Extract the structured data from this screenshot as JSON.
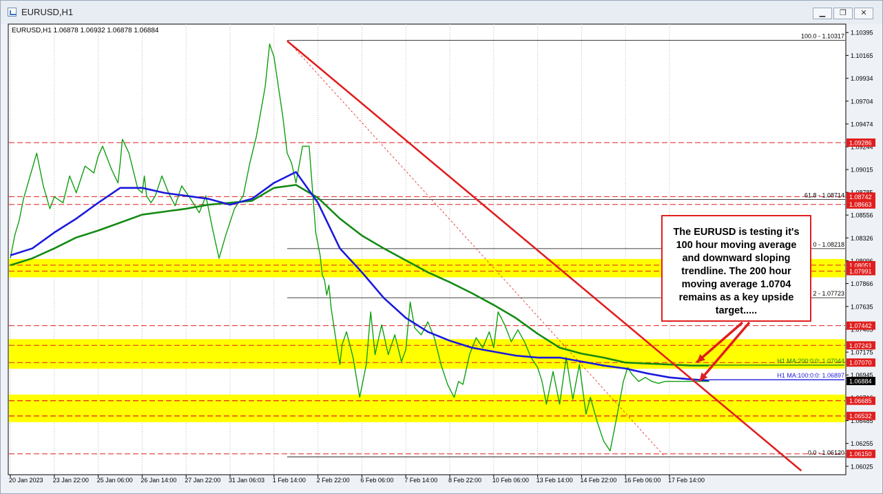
{
  "window": {
    "title": "EURUSD,H1",
    "buttons": [
      "minimize",
      "restore",
      "close"
    ]
  },
  "chart_header": "EURUSD,H1  1.06878 1.06932 1.06878 1.06884",
  "annotation": {
    "text": "The EURUSD is testing it's 100 hour moving average and downward sloping trendline. The 200 hour moving average 1.0704 remains as a key upside target....."
  },
  "colors": {
    "candle": "#0e9e0e",
    "ma100": "#1a1adc",
    "ma200": "#138a13",
    "trendline": "#e11e1e",
    "zone": "#ffff00",
    "level_line": "#e11e1e",
    "fib_line": "#000000"
  },
  "chart_data": {
    "type": "line",
    "symbol": "EURUSD",
    "timeframe": "H1",
    "ohlc_readout": {
      "open": 1.06878,
      "high": 1.06932,
      "low": 1.06878,
      "close": 1.06884
    },
    "ylim": [
      1.0594,
      1.1048
    ],
    "y_ticks": [
      "1.10395",
      "1.10165",
      "1.09934",
      "1.09704",
      "1.09474",
      "1.09244",
      "1.09015",
      "1.08785",
      "1.08556",
      "1.08326",
      "1.08096",
      "1.07866",
      "1.07635",
      "1.07405",
      "1.07175",
      "1.06945",
      "1.06716",
      "1.06485",
      "1.06255",
      "1.06025"
    ],
    "x_labels": [
      "20 Jan 2023",
      "23 Jan 22:00",
      "25 Jan 06:00",
      "26 Jan 14:00",
      "27 Jan 22:00",
      "31 Jan 06:03",
      "1 Feb 14:00",
      "2 Feb 22:00",
      "6 Feb 06:00",
      "7 Feb 14:00",
      "8 Feb 22:00",
      "10 Feb 06:00",
      "13 Feb 14:00",
      "14 Feb 22:00",
      "16 Feb 06:00",
      "17 Feb 14:00"
    ],
    "series": [
      {
        "name": "EURUSD,H1",
        "kind": "price",
        "x": [
          0,
          0.1,
          0.2,
          0.3,
          0.45,
          0.6,
          0.75,
          0.9,
          1,
          1.2,
          1.35,
          1.5,
          1.7,
          1.9,
          2,
          2.1,
          2.3,
          2.45,
          2.5,
          2.55,
          2.7,
          2.9,
          3,
          3.05,
          3.1,
          3.2,
          3.3,
          3.45,
          3.6,
          3.75,
          3.9,
          4.1,
          4.3,
          4.45,
          4.6,
          4.75,
          4.9,
          5.1,
          5.3,
          5.45,
          5.6,
          5.8,
          5.9,
          6,
          6.1,
          6.2,
          6.3,
          6.4,
          6.5,
          6.65,
          6.8,
          6.95,
          7.05,
          7.1,
          7.15,
          7.2,
          7.25,
          7.3,
          7.45,
          7.5,
          7.55,
          7.65,
          7.8,
          7.95,
          8.1,
          8.2,
          8.3,
          8.45,
          8.6,
          8.75,
          8.9,
          9,
          9.1,
          9.2,
          9.35,
          9.5,
          9.65,
          9.8,
          9.95,
          10.1,
          10.2,
          10.3,
          10.45,
          10.6,
          10.75,
          10.9,
          11,
          11.1,
          11.25,
          11.4,
          11.55,
          11.7,
          11.85,
          12,
          12.1,
          12.2,
          12.35,
          12.5,
          12.65,
          12.8,
          12.95,
          13.1,
          13.2,
          13.35,
          13.5,
          13.65,
          13.8,
          13.95,
          14.05,
          14.15,
          14.3,
          14.45,
          14.6,
          14.75,
          14.9,
          15.05,
          15.2,
          15.35,
          15.5,
          15.65,
          15.8,
          15.9
        ],
        "y": [
          1.0812,
          1.0835,
          1.085,
          1.0872,
          1.0895,
          1.0918,
          1.0885,
          1.0862,
          1.0874,
          1.0868,
          1.0895,
          1.0878,
          1.0905,
          1.0898,
          1.0915,
          1.0925,
          1.0902,
          1.0888,
          1.0908,
          1.0932,
          1.0918,
          1.0882,
          1.0878,
          1.0895,
          1.0875,
          1.0868,
          1.0875,
          1.0895,
          1.0878,
          1.0865,
          1.0885,
          1.0872,
          1.0858,
          1.0875,
          1.0842,
          1.0812,
          1.0835,
          1.0862,
          1.0875,
          1.0908,
          1.0935,
          1.0985,
          1.1028,
          1.1015,
          1.0985,
          1.0955,
          1.0918,
          1.0908,
          1.0888,
          1.0925,
          1.0925,
          1.0838,
          1.0815,
          1.0795,
          1.079,
          1.0775,
          1.0785,
          1.0762,
          1.0718,
          1.0705,
          1.0725,
          1.0738,
          1.0712,
          1.0672,
          1.0705,
          1.0758,
          1.0715,
          1.0745,
          1.0715,
          1.0735,
          1.0708,
          1.072,
          1.0768,
          1.0742,
          1.0735,
          1.0748,
          1.0732,
          1.0705,
          1.0685,
          1.0672,
          1.0688,
          1.0685,
          1.0715,
          1.0732,
          1.0722,
          1.0738,
          1.0722,
          1.0758,
          1.0745,
          1.0728,
          1.074,
          1.0728,
          1.0712,
          1.0702,
          1.0688,
          1.0665,
          1.0698,
          1.0665,
          1.0712,
          1.067,
          1.0705,
          1.0655,
          1.0672,
          1.0648,
          1.0628,
          1.0618,
          1.0652,
          1.0688,
          1.0702,
          1.0695,
          1.0688,
          1.0692,
          1.0688,
          1.0686,
          1.0688,
          1.0688,
          1.0688,
          1.0688,
          1.0688,
          1.0688,
          1.0688,
          1.0688
        ]
      },
      {
        "name": "H1 MA:100:0:0",
        "x": [
          0,
          0.5,
          1,
          1.5,
          2,
          2.5,
          3,
          3.5,
          4,
          4.5,
          5,
          5.5,
          6,
          6.5,
          7,
          7.5,
          8,
          8.5,
          9,
          9.5,
          10,
          10.5,
          11,
          11.5,
          12,
          12.5,
          13,
          13.5,
          14,
          14.5,
          15,
          15.5,
          15.9
        ],
        "y": [
          1.0815,
          1.0822,
          1.0838,
          1.0852,
          1.0868,
          1.0883,
          1.0883,
          1.0878,
          1.0875,
          1.0872,
          1.0866,
          1.0872,
          1.0888,
          1.0899,
          1.0868,
          1.0822,
          1.0798,
          1.0772,
          1.0752,
          1.0738,
          1.0729,
          1.0722,
          1.0718,
          1.0714,
          1.0712,
          1.0712,
          1.0708,
          1.0704,
          1.0701,
          1.0696,
          1.0692,
          1.069,
          1.0689
        ]
      },
      {
        "name": "H1 MA:200:0:0",
        "x": [
          0,
          0.5,
          1,
          1.5,
          2,
          2.5,
          3,
          3.5,
          4,
          4.5,
          5,
          5.5,
          6,
          6.5,
          7,
          7.5,
          8,
          8.5,
          9,
          9.5,
          10,
          10.5,
          11,
          11.5,
          12,
          12.5,
          13,
          13.5,
          14,
          14.5,
          15,
          15.5,
          15.9
        ],
        "y": [
          1.0805,
          1.0812,
          1.0822,
          1.0833,
          1.084,
          1.0848,
          1.0856,
          1.0859,
          1.0862,
          1.0866,
          1.0868,
          1.087,
          1.0883,
          1.0886,
          1.0873,
          1.0852,
          1.0835,
          1.0822,
          1.081,
          1.0798,
          1.0788,
          1.0777,
          1.0765,
          1.0752,
          1.0736,
          1.0722,
          1.0716,
          1.0712,
          1.0707,
          1.0706,
          1.0705,
          1.0704,
          1.0704
        ]
      }
    ],
    "price_labels": [
      {
        "value": "1.09286",
        "color": "#e11e1e"
      },
      {
        "value": "1.08742",
        "color": "#e11e1e"
      },
      {
        "value": "1.08663",
        "color": "#e11e1e"
      },
      {
        "value": "1.08051",
        "color": "#e11e1e"
      },
      {
        "value": "1.07991",
        "color": "#e11e1e"
      },
      {
        "value": "1.07442",
        "color": "#e11e1e"
      },
      {
        "value": "1.07243",
        "color": "#e11e1e"
      },
      {
        "value": "1.07070",
        "color": "#e11e1e"
      },
      {
        "value": "1.06884",
        "color": "#000000"
      },
      {
        "value": "1.06685",
        "color": "#e11e1e"
      },
      {
        "value": "1.06532",
        "color": "#e11e1e"
      },
      {
        "value": "1.06150",
        "color": "#e11e1e"
      }
    ],
    "horizontal_levels": [
      {
        "value": 1.09286,
        "style": "dashed"
      },
      {
        "value": 1.08742,
        "style": "dashed"
      },
      {
        "value": 1.08663,
        "style": "dashed"
      },
      {
        "value": 1.07442,
        "style": "dashed"
      },
      {
        "value": 1.06685,
        "style": "dashed"
      },
      {
        "value": 1.06532,
        "style": "dashed"
      },
      {
        "value": 1.0615,
        "style": "dashed"
      }
    ],
    "zones": [
      {
        "from": 1.07991,
        "to": 1.08051
      },
      {
        "from": 1.0707,
        "to": 1.07243
      },
      {
        "from": 1.06532,
        "to": 1.06685
      }
    ],
    "fibonacci": [
      {
        "label": "100.0 - 1.10317",
        "value": 1.10317
      },
      {
        "label": "61.8 - 1.08714",
        "value": 1.08714
      },
      {
        "label": "0 - 1.08218",
        "value": 1.08218
      },
      {
        "label": "2 - 1.07723",
        "value": 1.07723
      },
      {
        "label": "0.0 - 1.06120",
        "value": 1.0612
      }
    ],
    "ma_labels": [
      {
        "label": "H1 MA:200:0:0: 1.07044",
        "value": 1.07044
      },
      {
        "label": "H1 MA:100:0:0: 1.06897",
        "value": 1.06897
      }
    ],
    "trendline": {
      "x": [
        6.3,
        18.0
      ],
      "y": [
        1.1031,
        1.0598
      ]
    }
  }
}
